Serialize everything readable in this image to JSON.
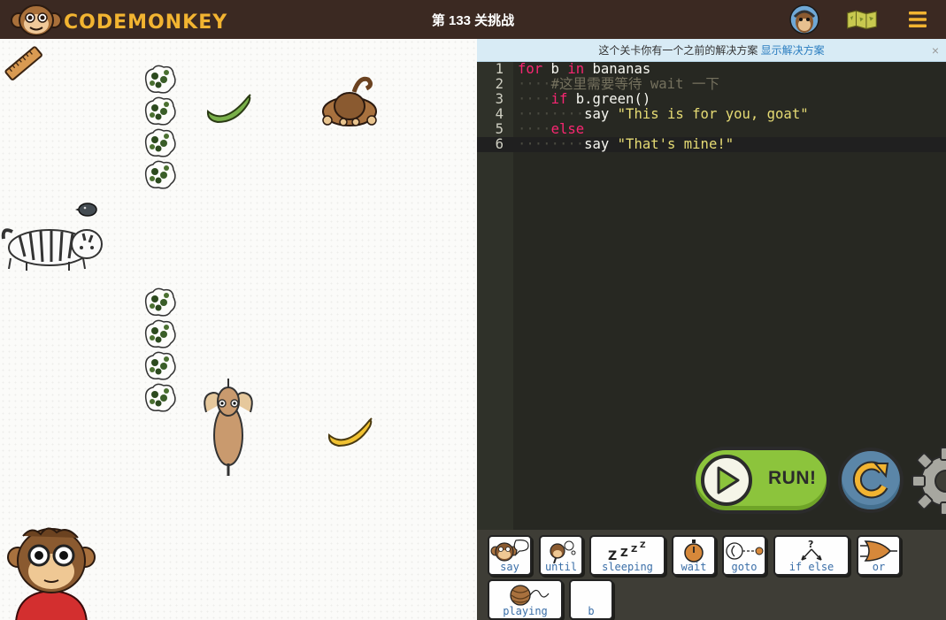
{
  "header": {
    "logo_text": "codemonkey",
    "level_title": "第 133 关挑战"
  },
  "notice": {
    "text": "这个关卡你有一个之前的解决方案 ",
    "link": "显示解决方案",
    "close": "×"
  },
  "editor": {
    "lines": [
      {
        "num": "1",
        "indent": "",
        "parts": [
          [
            "kw",
            "for"
          ],
          [
            "txt",
            " b "
          ],
          [
            "kw",
            "in"
          ],
          [
            "txt",
            " bananas"
          ]
        ]
      },
      {
        "num": "2",
        "indent": "····",
        "parts": [
          [
            "cm",
            "#这里需要等待 wait 一下"
          ]
        ]
      },
      {
        "num": "3",
        "indent": "····",
        "parts": [
          [
            "kw",
            "if"
          ],
          [
            "txt",
            " b.green()"
          ]
        ]
      },
      {
        "num": "4",
        "indent": "········",
        "parts": [
          [
            "txt",
            "say "
          ],
          [
            "str",
            "\"This is for you, goat\""
          ]
        ]
      },
      {
        "num": "5",
        "indent": "····",
        "parts": [
          [
            "kw",
            "else"
          ]
        ]
      },
      {
        "num": "6",
        "indent": "········",
        "parts": [
          [
            "txt",
            "say "
          ],
          [
            "str",
            "\"That's mine!\""
          ]
        ]
      }
    ]
  },
  "controls": {
    "run_label": "RUN!"
  },
  "snippets": [
    {
      "label": "say",
      "icon": "monkey-speech-icon"
    },
    {
      "label": "until",
      "icon": "monkey-think-icon"
    },
    {
      "label": "sleeping",
      "icon": "zzz-icon"
    },
    {
      "label": "wait",
      "icon": "stopwatch-icon"
    },
    {
      "label": "goto",
      "icon": "goto-icon"
    },
    {
      "label": "if else",
      "icon": "branch-icon"
    },
    {
      "label": "or",
      "icon": "or-gate-icon"
    },
    {
      "label": "playing",
      "icon": "yarn-ball-icon"
    },
    {
      "label": "b",
      "icon": ""
    }
  ]
}
